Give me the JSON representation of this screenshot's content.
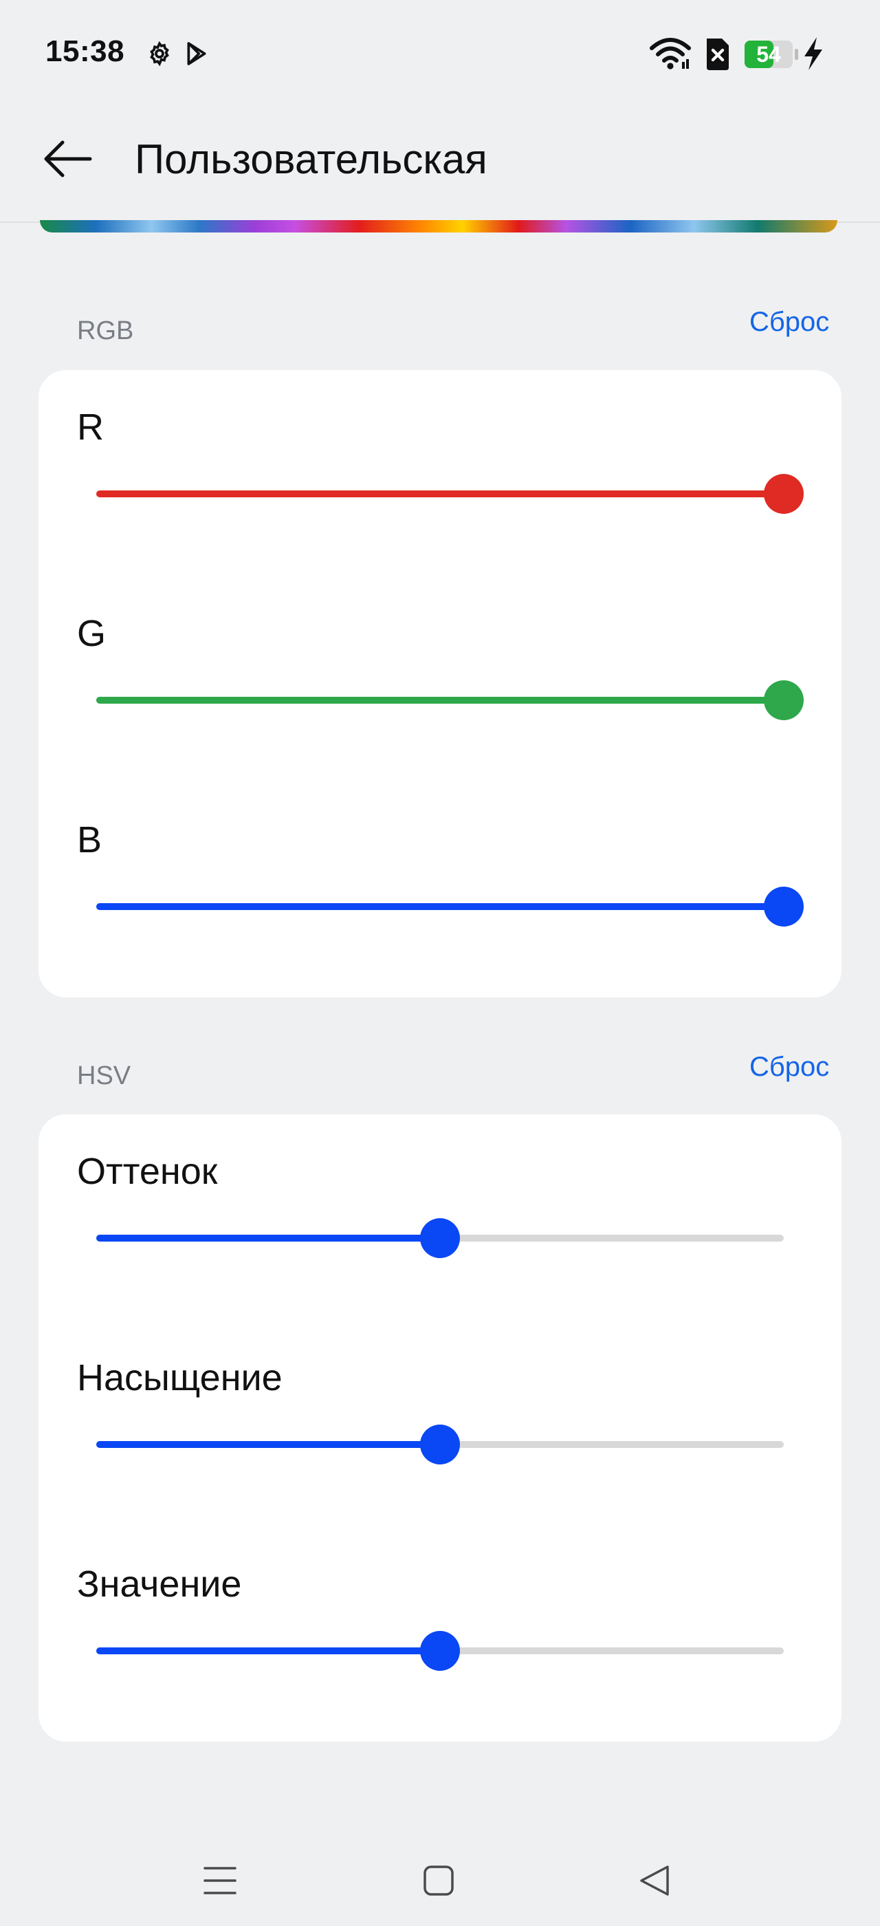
{
  "status_bar": {
    "time": "15:38",
    "battery_level": "54",
    "icons": [
      "settings-gear-icon",
      "play-store-icon",
      "wifi-icon",
      "no-sim-icon",
      "battery-icon",
      "charging-bolt-icon"
    ]
  },
  "app_bar": {
    "back_icon": "arrow-back-icon",
    "title": "Пользовательская"
  },
  "rgb_section": {
    "label": "RGB",
    "reset_label": "Сброс",
    "sliders": [
      {
        "label": "R",
        "value": 1.0,
        "color": "#e02a24"
      },
      {
        "label": "G",
        "value": 1.0,
        "color": "#2ea84a"
      },
      {
        "label": "B",
        "value": 1.0,
        "color": "#0a47f5"
      }
    ]
  },
  "hsv_section": {
    "label": "HSV",
    "reset_label": "Сброс",
    "sliders": [
      {
        "label": "Оттенок",
        "value": 0.5,
        "color": "#0a47f5"
      },
      {
        "label": "Насыщение",
        "value": 0.5,
        "color": "#0a47f5"
      },
      {
        "label": "Значение",
        "value": 0.5,
        "color": "#0a47f5"
      }
    ]
  },
  "nav_bar": {
    "icons": [
      "menu-icon",
      "home-icon",
      "back-triangle-icon"
    ]
  },
  "colors": {
    "accent": "#1565e6",
    "background": "#eff0f2",
    "card": "#ffffff",
    "track_inactive": "#d8d8d8"
  }
}
